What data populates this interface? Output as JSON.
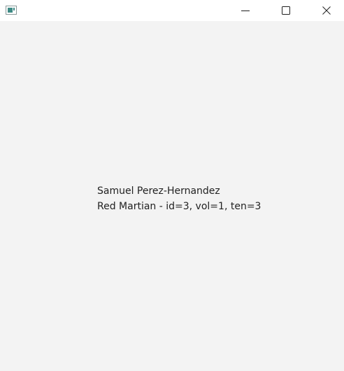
{
  "titlebar": {
    "app_icon": "window-app-icon",
    "buttons": {
      "minimize_icon": "minimize-icon",
      "maximize_icon": "maximize-icon",
      "close_icon": "close-icon"
    }
  },
  "content": {
    "line1": "Samuel Perez-Hernandez",
    "line2": "Red Martian - id=3, vol=1, ten=3"
  }
}
